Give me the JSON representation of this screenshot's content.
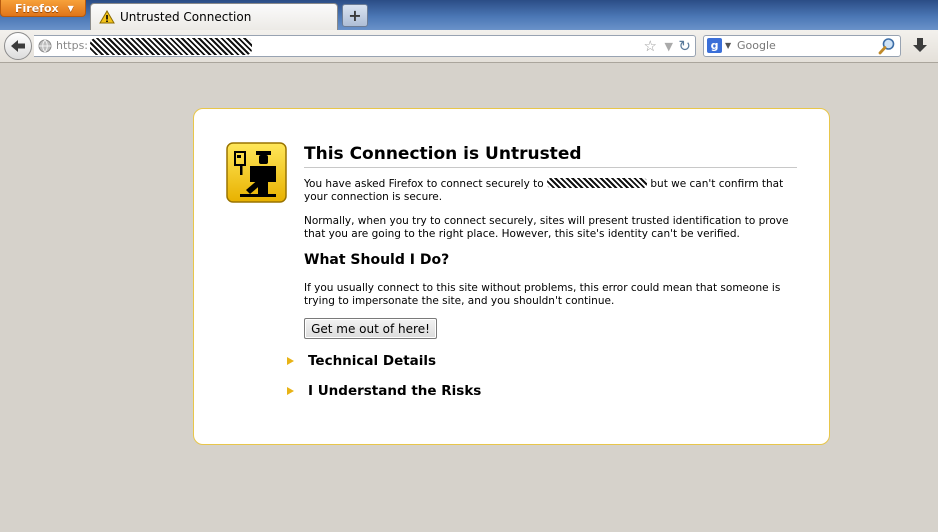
{
  "browser": {
    "menu_button": "Firefox",
    "tab_title": "Untrusted Connection",
    "new_tab_symbol": "+",
    "url_scheme": "https:",
    "search_placeholder": "Google",
    "search_engine_letter": "g",
    "icons": [
      "back-arrow-icon",
      "globe-icon",
      "bookmark-star-icon",
      "history-dropdown-icon",
      "reload-icon",
      "google-icon",
      "magnifier-icon",
      "downloads-icon"
    ]
  },
  "error_page": {
    "title": "This Connection is Untrusted",
    "para1_prefix": "You have asked Firefox to connect securely to",
    "para1_suffix": "but we can't confirm that your connection is secure.",
    "para2": "Normally, when you try to connect securely, sites will present trusted identification to prove that you are going to the right place. However, this site's identity can't be verified.",
    "what_heading": "What Should I Do?",
    "para3": "If you usually connect to this site without problems, this error could mean that someone is trying to impersonate the site, and you shouldn't continue.",
    "get_out_button": "Get me out of here!",
    "technical_details": "Technical Details",
    "understand_risks": "I Understand the Risks"
  },
  "colors": {
    "page_background": "#d6d2cb",
    "box_border": "#e8c64a",
    "expander_triangle": "#e8b316",
    "firefox_button": "#e8861f"
  }
}
